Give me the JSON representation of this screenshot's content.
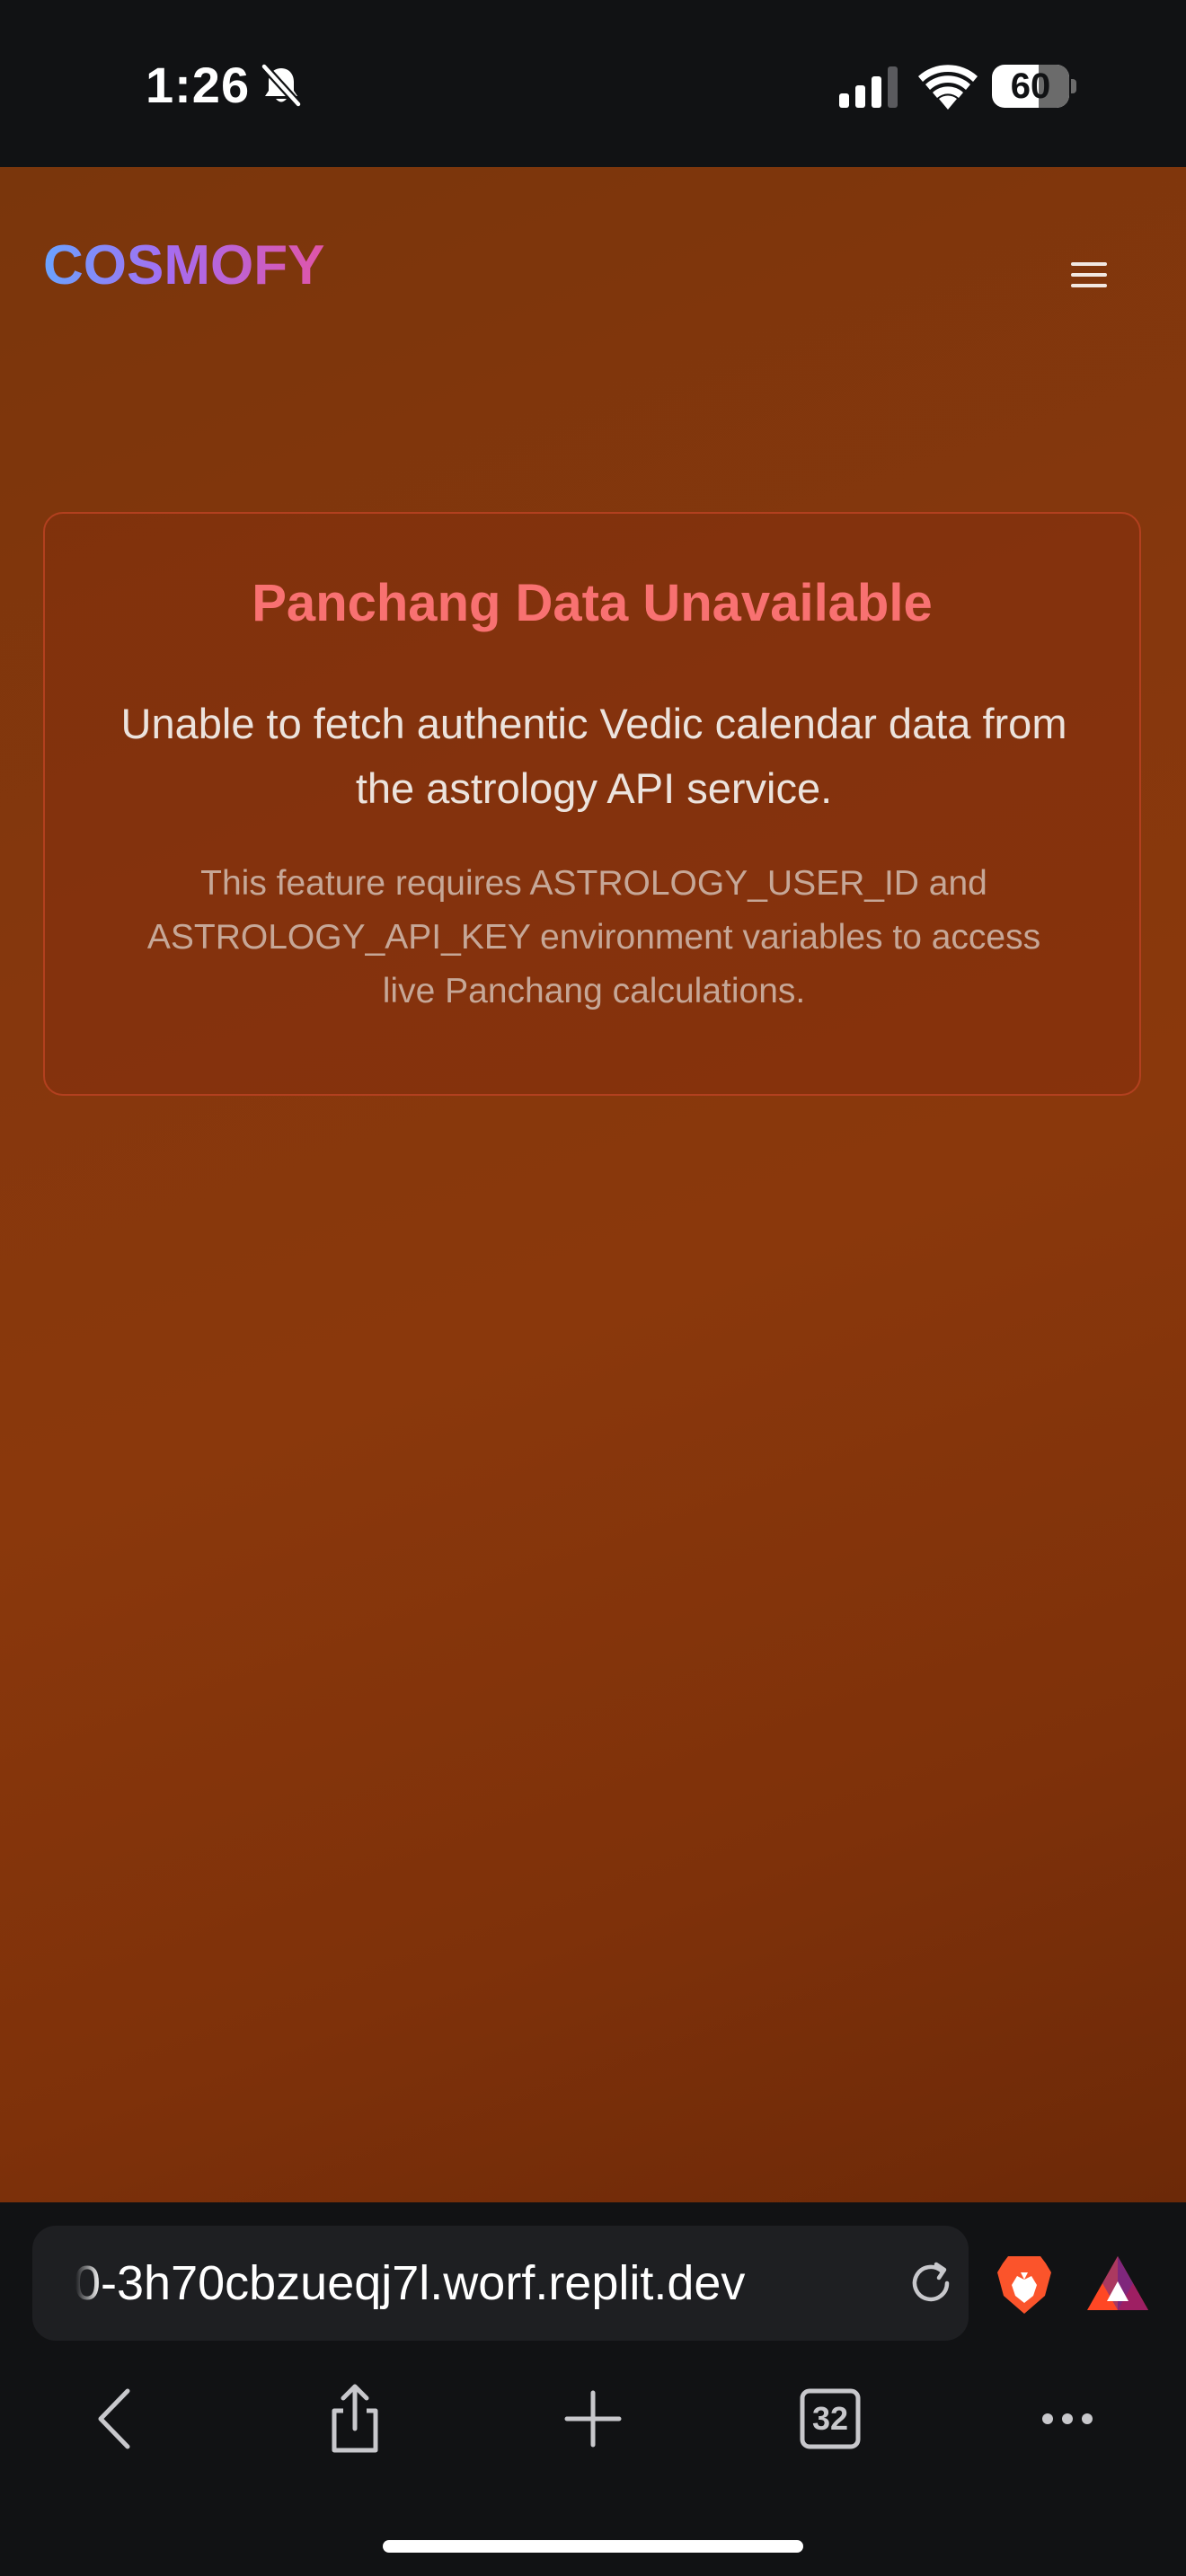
{
  "status_bar": {
    "time": "1:26",
    "battery": "60"
  },
  "nav": {
    "logo": "COSMOFY"
  },
  "error": {
    "title": "Panchang Data Unavailable",
    "message": "Unable to fetch authentic Vedic calendar data from the astrology API service.",
    "detail": "This feature requires ASTROLOGY_USER_ID and ASTROLOGY_API_KEY environment variables to access live Panchang calculations."
  },
  "browser": {
    "url": "0-3h70cbzueqj7l.worf.replit.dev",
    "tab_count": "32"
  },
  "colors": {
    "error_title": "#f87171",
    "page_background": "#86370d",
    "logo_gradient": [
      "#6aa3ff",
      "#a66cf0",
      "#e055a8"
    ]
  }
}
